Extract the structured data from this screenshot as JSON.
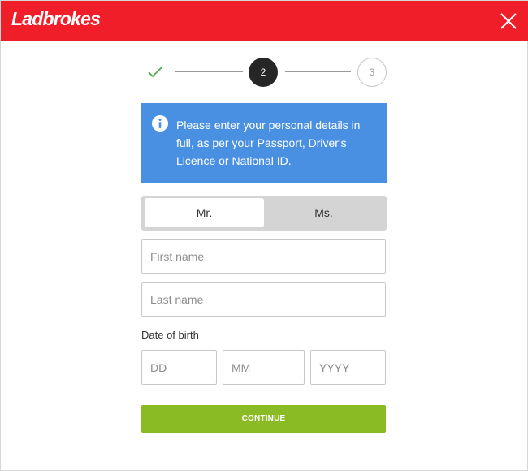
{
  "header": {
    "brand": "Ladbrokes",
    "brand_color": "#f01e28",
    "close_icon": "close-icon"
  },
  "stepper": {
    "step1_icon": "checkmark-icon",
    "step1_state": "completed",
    "step2_label": "2",
    "step2_state": "active",
    "step3_label": "3",
    "step3_state": "upcoming"
  },
  "info": {
    "icon": "info-icon",
    "text": "Please enter your personal details in full, as per your Passport, Driver's Licence or National ID.",
    "bg_color": "#4a90e2"
  },
  "title_toggle": {
    "options": [
      "Mr.",
      "Ms."
    ],
    "selected": "Mr."
  },
  "form": {
    "first_name_placeholder": "First name",
    "last_name_placeholder": "Last name",
    "dob_label": "Date of birth",
    "dd_placeholder": "DD",
    "mm_placeholder": "MM",
    "yyyy_placeholder": "YYYY"
  },
  "continue": {
    "label": "CONTINUE",
    "color": "#8aba24"
  }
}
